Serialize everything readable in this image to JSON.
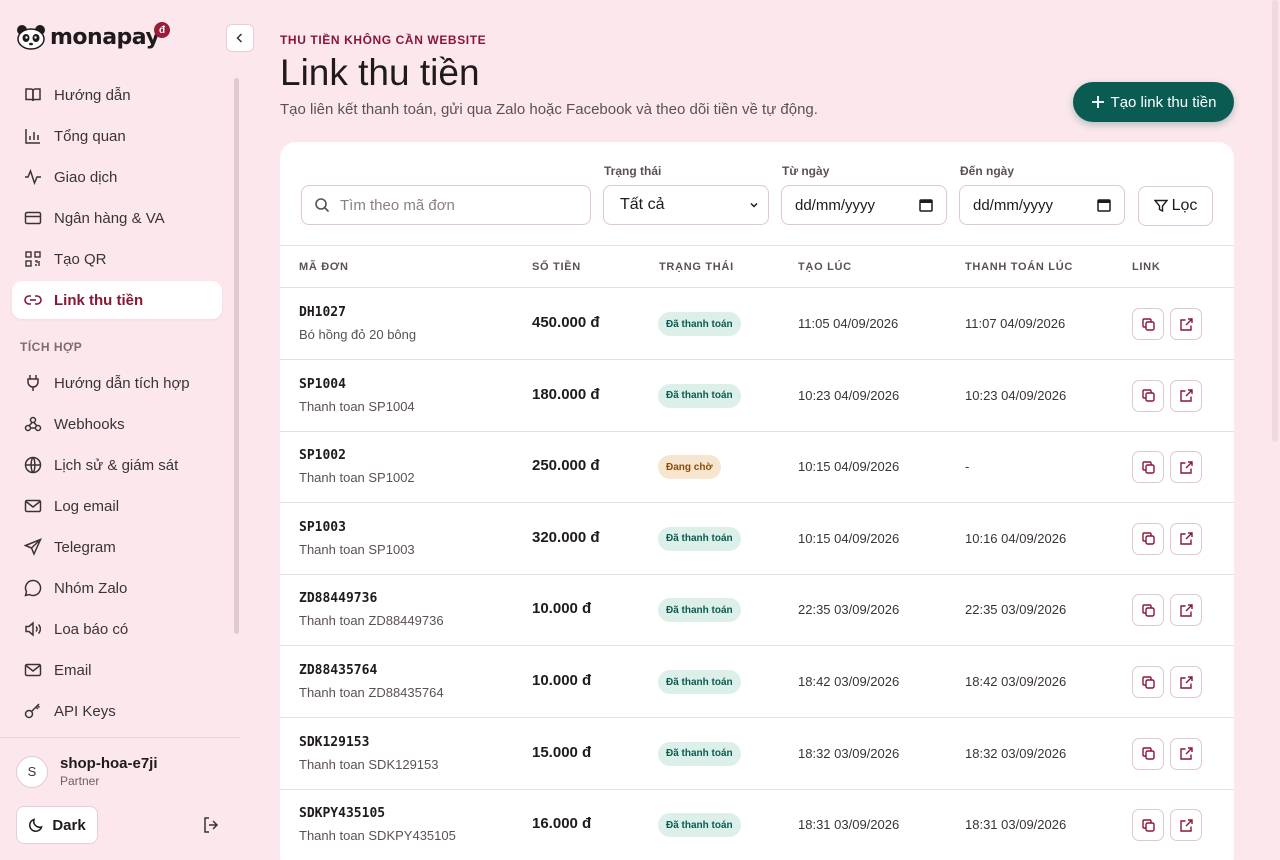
{
  "brand": {
    "name": "monapay",
    "badge": "đ"
  },
  "sidebar": {
    "items": [
      {
        "label": "Hướng dẫn",
        "icon": "book-icon"
      },
      {
        "label": "Tổng quan",
        "icon": "bar-chart-icon"
      },
      {
        "label": "Giao dịch",
        "icon": "activity-icon"
      },
      {
        "label": "Ngân hàng & VA",
        "icon": "credit-card-icon"
      },
      {
        "label": "Tạo QR",
        "icon": "qr-icon"
      },
      {
        "label": "Link thu tiền",
        "icon": "link-icon",
        "active": true
      }
    ],
    "section_label": "TÍCH HỢP",
    "integration_items": [
      {
        "label": "Hướng dẫn tích hợp",
        "icon": "plug-icon"
      },
      {
        "label": "Webhooks",
        "icon": "webhook-icon"
      },
      {
        "label": "Lịch sử & giám sát",
        "icon": "globe-icon"
      },
      {
        "label": "Log email",
        "icon": "mail-icon"
      },
      {
        "label": "Telegram",
        "icon": "send-icon"
      },
      {
        "label": "Nhóm Zalo",
        "icon": "chat-icon"
      },
      {
        "label": "Loa báo có",
        "icon": "speaker-icon"
      },
      {
        "label": "Email",
        "icon": "mail-icon"
      },
      {
        "label": "API Keys",
        "icon": "key-icon"
      }
    ],
    "user": {
      "initial": "S",
      "name": "shop-hoa-e7ji",
      "role": "Partner"
    },
    "dark_label": "Dark"
  },
  "header": {
    "eyebrow": "THU TIỀN KHÔNG CẦN WEBSITE",
    "title": "Link thu tiền",
    "subtitle": "Tạo liên kết thanh toán, gửi qua Zalo hoặc Facebook và theo dõi tiền về tự động.",
    "create_button": "Tạo link thu tiền"
  },
  "filters": {
    "search_placeholder": "Tìm theo mã đơn",
    "status_label": "Trạng thái",
    "status_value": "Tất cả",
    "from_label": "Từ ngày",
    "from_value": "dd/mm/yyyy",
    "to_label": "Đến ngày",
    "to_value": "dd/mm/yyyy",
    "filter_button": "Lọc"
  },
  "table": {
    "columns": [
      "MÃ ĐƠN",
      "SỐ TIỀN",
      "TRẠNG THÁI",
      "TẠO LÚC",
      "THANH TOÁN LÚC",
      "LINK"
    ],
    "rows": [
      {
        "code": "DH1027",
        "desc": "Bó hồng đỏ 20 bông",
        "amount": "450.000 đ",
        "status": "Đã thanh toán",
        "status_type": "paid",
        "created": "11:05 04/09/2026",
        "paid": "11:07 04/09/2026"
      },
      {
        "code": "SP1004",
        "desc": "Thanh toan SP1004",
        "amount": "180.000 đ",
        "status": "Đã thanh toán",
        "status_type": "paid",
        "created": "10:23 04/09/2026",
        "paid": "10:23 04/09/2026"
      },
      {
        "code": "SP1002",
        "desc": "Thanh toan SP1002",
        "amount": "250.000 đ",
        "status": "Đang chờ",
        "status_type": "pending",
        "created": "10:15 04/09/2026",
        "paid": "-"
      },
      {
        "code": "SP1003",
        "desc": "Thanh toan SP1003",
        "amount": "320.000 đ",
        "status": "Đã thanh toán",
        "status_type": "paid",
        "created": "10:15 04/09/2026",
        "paid": "10:16 04/09/2026"
      },
      {
        "code": "ZD88449736",
        "desc": "Thanh toan ZD88449736",
        "amount": "10.000 đ",
        "status": "Đã thanh toán",
        "status_type": "paid",
        "created": "22:35 03/09/2026",
        "paid": "22:35 03/09/2026"
      },
      {
        "code": "ZD88435764",
        "desc": "Thanh toan ZD88435764",
        "amount": "10.000 đ",
        "status": "Đã thanh toán",
        "status_type": "paid",
        "created": "18:42 03/09/2026",
        "paid": "18:42 03/09/2026"
      },
      {
        "code": "SDK129153",
        "desc": "Thanh toan SDK129153",
        "amount": "15.000 đ",
        "status": "Đã thanh toán",
        "status_type": "paid",
        "created": "18:32 03/09/2026",
        "paid": "18:32 03/09/2026"
      },
      {
        "code": "SDKPY435105",
        "desc": "Thanh toan SDKPY435105",
        "amount": "16.000 đ",
        "status": "Đã thanh toán",
        "status_type": "paid",
        "created": "18:31 03/09/2026",
        "paid": "18:31 03/09/2026"
      }
    ]
  },
  "colors": {
    "accent": "#8a1636",
    "primary": "#0a5c52",
    "background": "#fce8ec"
  }
}
